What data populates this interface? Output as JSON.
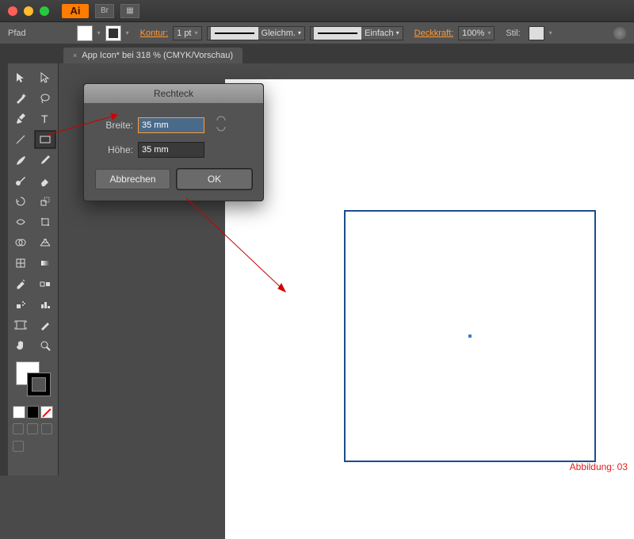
{
  "titlebar": {
    "app": "Ai"
  },
  "ctrlbar": {
    "path": "Pfad",
    "kontur": "Kontur:",
    "stroke_weight": "1 pt",
    "dash1": "Gleichm.",
    "dash2": "Einfach",
    "opacity_label": "Deckkraft:",
    "opacity": "100%",
    "style_label": "Stil:"
  },
  "tab": {
    "close": "×",
    "title": "App Icon* bei 318 % (CMYK/Vorschau)"
  },
  "dialog": {
    "title": "Rechteck",
    "width_label": "Breite:",
    "width_value": "35 mm",
    "height_label": "Höhe:",
    "height_value": "35 mm",
    "cancel": "Abbrechen",
    "ok": "OK"
  },
  "caption": "Abbildung: 03"
}
